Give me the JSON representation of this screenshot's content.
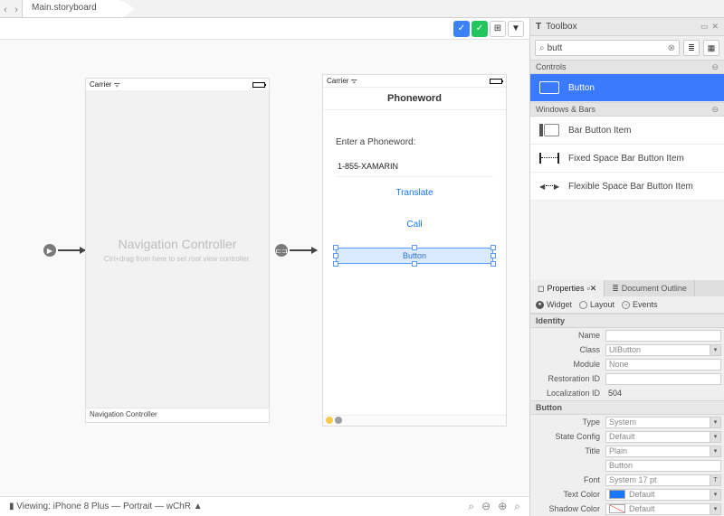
{
  "tabs": {
    "nav_back": "‹",
    "nav_fwd": "›",
    "file": "Main.storyboard"
  },
  "minibar": {
    "btn1": "✓",
    "btn2": "✓",
    "btn3": "⊞",
    "btn4": "▼"
  },
  "canvas": {
    "nav_controller": {
      "status_carrier": "Carrier",
      "title": "Navigation Controller",
      "sub": "Ctrl+drag from here to set root view controller.",
      "footer": "Navigation Controller"
    },
    "phone": {
      "status_carrier": "Carrier",
      "header": "Phoneword",
      "prompt": "Enter a Phoneword:",
      "input_value": "1-855-XAMARIN",
      "btn_translate": "Translate",
      "btn_call": "Call",
      "btn_new": "Button"
    },
    "segue1": "▶",
    "segue2": "⊏⊐"
  },
  "status": {
    "viewing": "Viewing: iPhone 8 Plus — Portrait — wChR ▲",
    "zoom": [
      "⌕",
      "⊖",
      "⊕",
      "⌕"
    ]
  },
  "toolbox": {
    "title": "Toolbox",
    "search_value": "butt",
    "controls_section": "Controls",
    "item_button": "Button",
    "windows_section": "Windows & Bars",
    "item_barbutton": "Bar Button Item",
    "item_fixed": "Fixed Space Bar Button Item",
    "item_flex": "Flexible Space Bar Button Item"
  },
  "properties": {
    "tab_properties": "Properties",
    "tab_outline": "Document Outline",
    "sub_widget": "Widget",
    "sub_layout": "Layout",
    "sub_events": "Events",
    "grp_identity": "Identity",
    "rows_identity": {
      "name_lbl": "Name",
      "name_val": "",
      "class_lbl": "Class",
      "class_val": "UIButton",
      "module_lbl": "Module",
      "module_val": "None",
      "restid_lbl": "Restoration ID",
      "restid_val": "",
      "locid_lbl": "Localization ID",
      "locid_val": "504"
    },
    "grp_button": "Button",
    "rows_button": {
      "type_lbl": "Type",
      "type_val": "System",
      "state_lbl": "State Config",
      "state_val": "Default",
      "title_lbl": "Title",
      "title_val": "Plain",
      "title2_val": "Button",
      "font_lbl": "Font",
      "font_val": "System 17 pt",
      "textcolor_lbl": "Text Color",
      "textcolor_val": "Default",
      "shadow_lbl": "Shadow Color",
      "shadow_val": "Default"
    }
  }
}
